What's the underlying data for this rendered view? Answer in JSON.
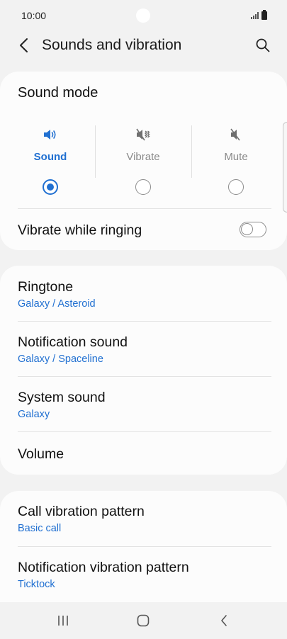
{
  "status_bar": {
    "time": "10:00"
  },
  "app_bar": {
    "title": "Sounds and vibration",
    "back_icon": "back-arrow-icon",
    "search_icon": "search-icon"
  },
  "sound_mode": {
    "title": "Sound mode",
    "modes": [
      {
        "label": "Sound",
        "icon": "speaker-on-icon",
        "selected": true
      },
      {
        "label": "Vibrate",
        "icon": "vibrate-icon",
        "selected": false
      },
      {
        "label": "Mute",
        "icon": "speaker-mute-icon",
        "selected": false
      }
    ],
    "vibrate_while_ringing": {
      "label": "Vibrate while ringing",
      "enabled": false
    }
  },
  "sounds": {
    "items": [
      {
        "label": "Ringtone",
        "value": "Galaxy / Asteroid"
      },
      {
        "label": "Notification sound",
        "value": "Galaxy / Spaceline"
      },
      {
        "label": "System sound",
        "value": "Galaxy"
      },
      {
        "label": "Volume",
        "value": ""
      }
    ]
  },
  "vibration": {
    "items": [
      {
        "label": "Call vibration pattern",
        "value": "Basic call"
      },
      {
        "label": "Notification vibration pattern",
        "value": "Ticktock"
      }
    ]
  },
  "colors": {
    "accent": "#2170d1",
    "background": "#f2f2f2",
    "card": "#fcfcfc"
  },
  "nav_bar": {
    "icons": [
      "recent-apps-icon",
      "home-icon",
      "back-icon"
    ]
  }
}
